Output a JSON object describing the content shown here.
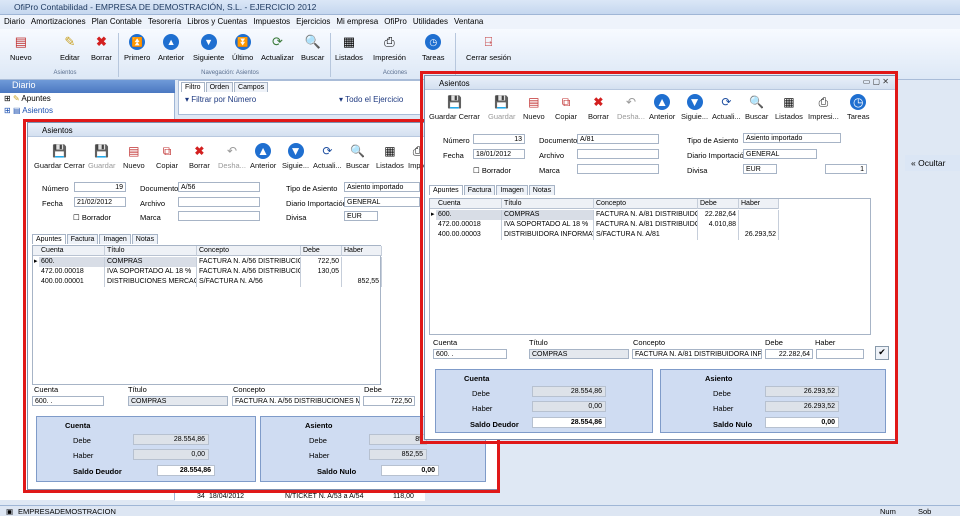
{
  "app": {
    "title": "OfiPro Contabilidad - EMPRESA DE DEMOSTRACIÓN, S.L. - EJERCICIO 2012"
  },
  "menu": [
    "Diario",
    "Amortizaciones",
    "Plan Contable",
    "Tesorería",
    "Libros y Cuentas",
    "Impuestos",
    "Ejercicios",
    "Mi empresa",
    "OfiPro",
    "Utilidades",
    "Ventana"
  ],
  "ribbon": {
    "nuevo": "Nuevo",
    "editar": "Editar",
    "borrar": "Borrar",
    "primero": "Primero",
    "anterior": "Anterior",
    "siguiente": "Siguiente",
    "ultimo": "Último",
    "actualizar": "Actualizar",
    "buscar": "Buscar",
    "listados": "Listados",
    "impresion": "Impresión",
    "tareas": "Tareas",
    "cerrar_sesion": "Cerrar sesión",
    "grp_asientos": "Asientos",
    "grp_nav": "Navegación: Asientos",
    "grp_acciones": "Acciones"
  },
  "sidebar": {
    "title": "Diario",
    "items": [
      "Apuntes",
      "Asientos"
    ]
  },
  "bg": {
    "tabs": [
      "Filtro",
      "Orden",
      "Campos"
    ],
    "filter": "Filtrar por Número",
    "year": "Todo el Ejercicio",
    "ocultar": "Ocultar",
    "row": {
      "num": "34",
      "date": "18/04/2012",
      "concepto": "N/TICKET N. A/53 a A/54",
      "importe": "118,00"
    }
  },
  "w1": {
    "title": "Asientos",
    "tb": {
      "guardar_cerrar": "Guardar Cerrar",
      "guardar": "Guardar",
      "nuevo": "Nuevo",
      "copiar": "Copiar",
      "borrar": "Borrar",
      "deshacer": "Desha...",
      "anterior": "Anterior",
      "siguiente": "Siguie...",
      "actualizar": "Actuali...",
      "buscar": "Buscar",
      "listados": "Listados",
      "impresion": "Impre"
    },
    "labels": {
      "numero": "Número",
      "fecha": "Fecha",
      "borrador": "Borrador",
      "documento": "Documento",
      "archivo": "Archivo",
      "marca": "Marca",
      "tipo": "Tipo de Asiento",
      "diario": "Diario Importación",
      "divisa": "Divisa"
    },
    "values": {
      "numero": "19",
      "fecha": "21/02/2012",
      "documento": "A/56",
      "tipo": "Asiento importado",
      "diario": "GENERAL",
      "divisa": "EUR"
    },
    "tabs": [
      "Apuntes",
      "Factura",
      "Imagen",
      "Notas"
    ],
    "cols": [
      "Cuenta",
      "Título",
      "Concepto",
      "Debe",
      "Haber"
    ],
    "rows": [
      [
        "600.",
        "COMPRAS",
        "FACTURA N. A/56 DISTRIBUCION",
        "722,50",
        ""
      ],
      [
        "472.00.00018",
        "IVA SOPORTADO AL 18 %",
        "FACTURA N. A/56 DISTRIBUCION",
        "130,05",
        ""
      ],
      [
        "400.00.00001",
        "DISTRIBUCIONES MERCAGA",
        "S/FACTURA N. A/56",
        "",
        "852,55"
      ]
    ],
    "edit": {
      "cuenta": "600.  .",
      "titulo": "COMPRAS",
      "concepto": "FACTURA N. A/56 DISTRIBUCIONES MEI",
      "debe": "722,50"
    },
    "sum": {
      "cuenta": "Cuenta",
      "asiento": "Asiento",
      "debe": "Debe",
      "haber": "Haber",
      "c_debe": "28.554,86",
      "c_haber": "0,00",
      "saldo_deudor": "Saldo Deudor",
      "c_saldo": "28.554,86",
      "a_debe": "85",
      "a_haber": "852,55",
      "saldo_nulo": "Saldo Nulo",
      "a_saldo": "0,00"
    }
  },
  "w2": {
    "title": "Asientos",
    "tb": {
      "guardar_cerrar": "Guardar Cerrar",
      "guardar": "Guardar",
      "nuevo": "Nuevo",
      "copiar": "Copiar",
      "borrar": "Borrar",
      "deshacer": "Desha...",
      "anterior": "Anterior",
      "siguiente": "Siguie...",
      "actualizar": "Actuali...",
      "buscar": "Buscar",
      "listados": "Listados",
      "impresion": "Impresi...",
      "tareas": "Tareas"
    },
    "values": {
      "numero": "13",
      "fecha": "18/01/2012",
      "documento": "A/81",
      "tipo": "Asiento importado",
      "diario": "GENERAL",
      "divisa": "EUR",
      "cambio": "1"
    },
    "rows": [
      [
        "600.",
        "COMPRAS",
        "FACTURA N. A/81 DISTRIBUIDOR",
        "22.282,64",
        ""
      ],
      [
        "472.00.00018",
        "IVA SOPORTADO AL 18 %",
        "FACTURA N. A/81 DISTRIBUIDOR",
        "4.010,88",
        ""
      ],
      [
        "400.00.00003",
        "DISTRIBUIDORA INFORMATI",
        "S/FACTURA N. A/81",
        "",
        "26.293,52"
      ]
    ],
    "edit": {
      "cuenta": "600.  .",
      "titulo": "COMPRAS",
      "concepto": "FACTURA N. A/81 DISTRIBUIDORA INFO",
      "debe": "22.282,64"
    },
    "sum": {
      "c_debe": "28.554,86",
      "c_haber": "0,00",
      "c_saldo": "28.554,86",
      "a_debe": "26.293,52",
      "a_haber": "26.293,52",
      "a_saldo": "0,00"
    }
  },
  "status": {
    "company": "EMPRESADEMOSTRACION",
    "num": "Num",
    "sob": "Sob"
  }
}
